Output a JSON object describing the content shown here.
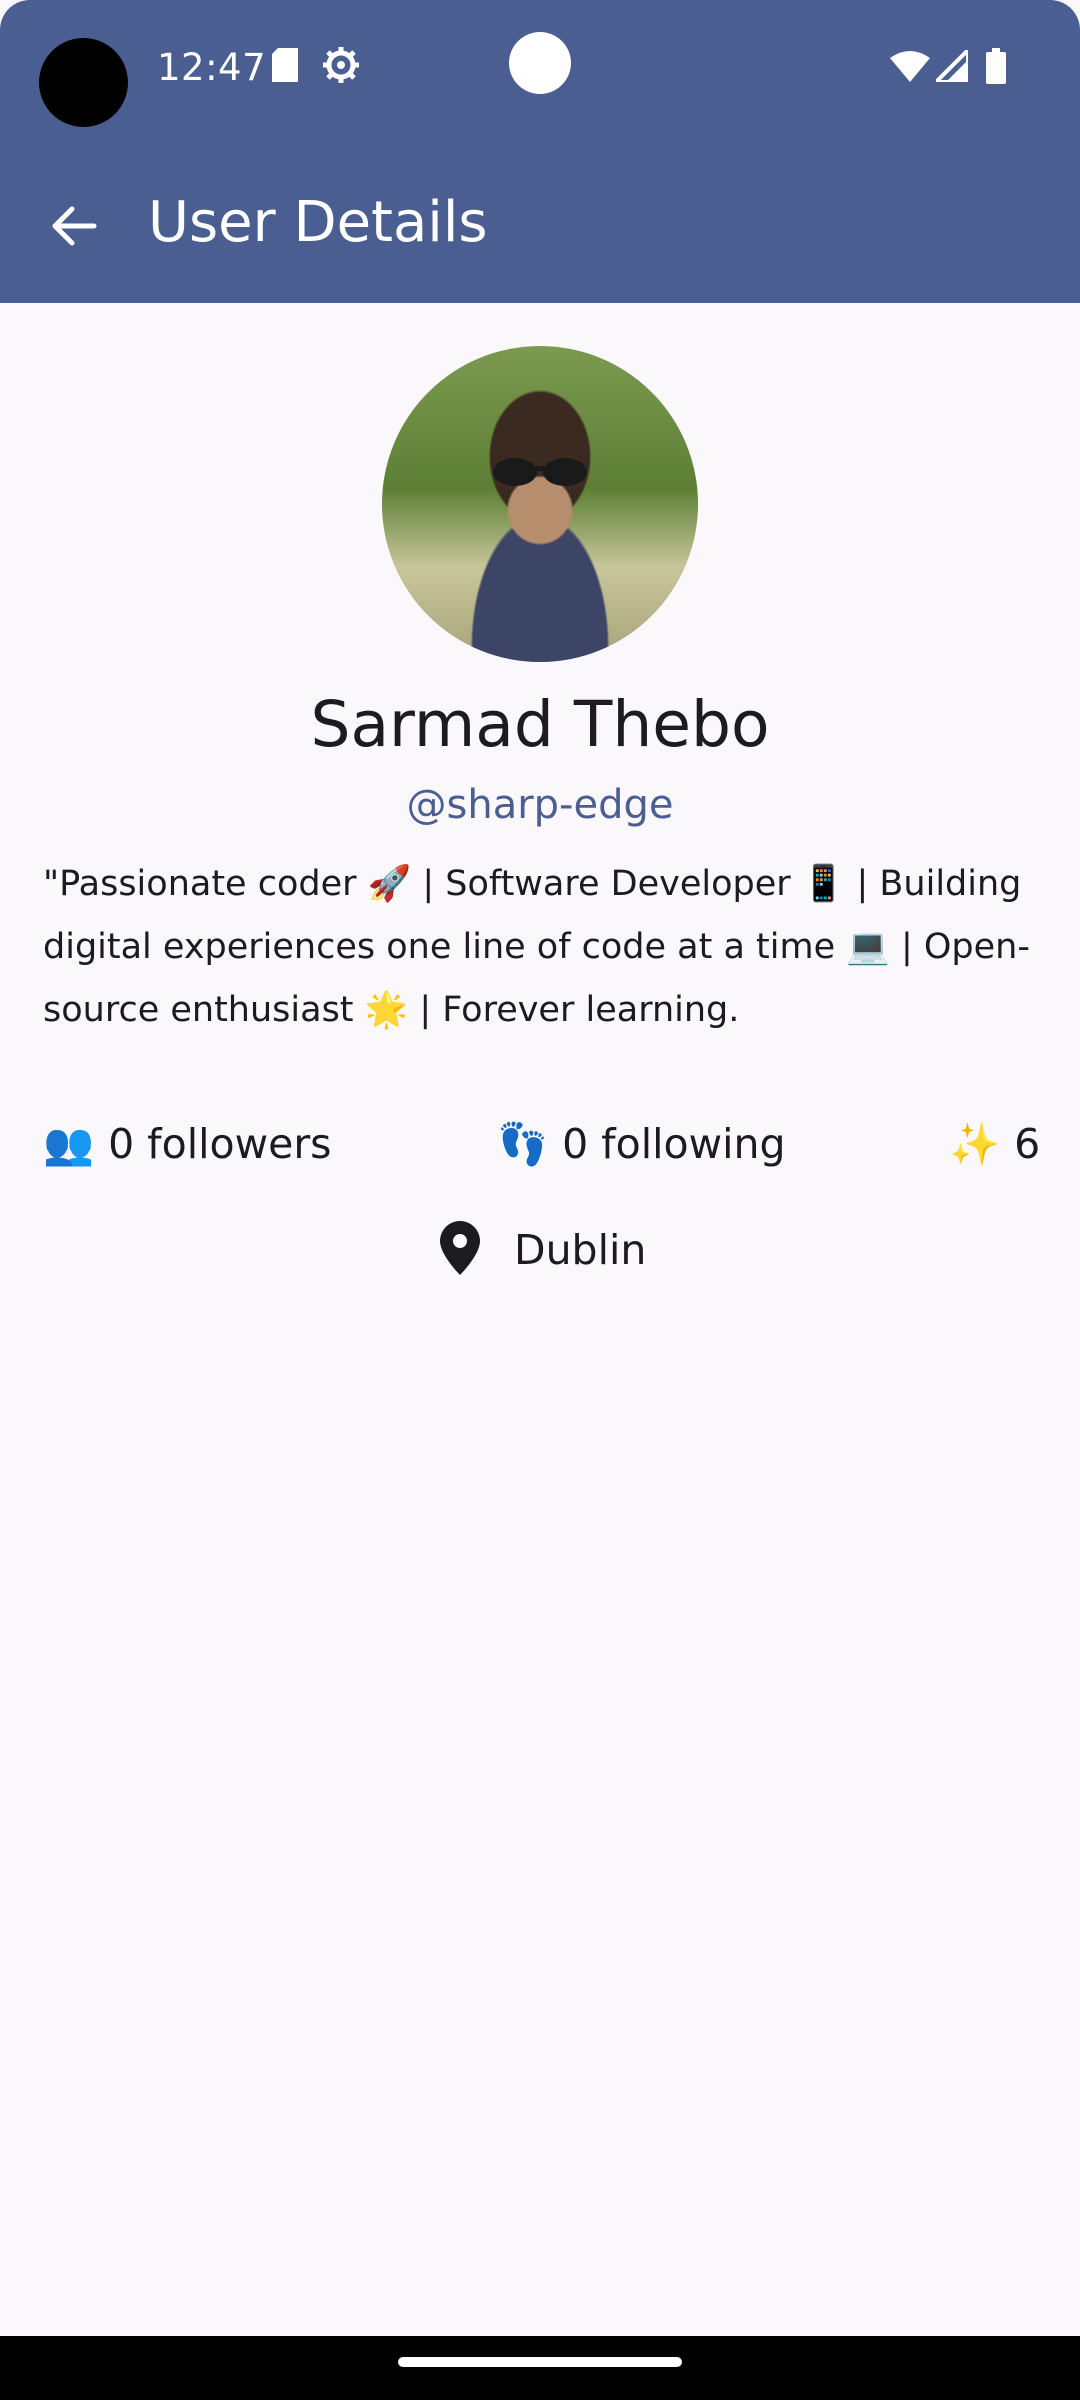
{
  "status_bar": {
    "time": "12:47",
    "icons": [
      "sd-card-icon",
      "settings-icon",
      "wifi-icon",
      "signal-icon",
      "battery-icon"
    ]
  },
  "app_bar": {
    "title": "User Details",
    "back_icon": "arrow-back-icon",
    "background": "#4B5E92"
  },
  "profile": {
    "name": "Sarmad Thebo",
    "handle": "@sharp-edge",
    "bio": "\"Passionate coder 🚀 | Software Developer 📱 | Building digital experiences one line of code at a time 💻 | Open-source enthusiast 🌟 | Forever learning.",
    "stats": {
      "followers_emoji": "👥",
      "followers": "0 followers",
      "following_emoji": "👣",
      "following": "0 following",
      "stars_emoji": "✨",
      "stars": "6"
    },
    "location_icon": "location-pin-icon",
    "location": "Dublin"
  },
  "colors": {
    "accent": "#4B5E92",
    "background": "#FBF8FC",
    "text": "#1C1B1F"
  }
}
